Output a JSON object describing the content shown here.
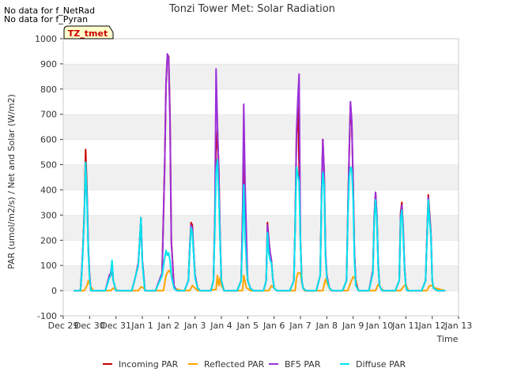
{
  "notes": [
    "No data for f_NetRad",
    "No data for f_Pyran"
  ],
  "site_badge": "TZ_tmet",
  "chart_data": {
    "type": "line",
    "title": "Tonzi Tower Met: Solar Radiation",
    "xlabel": "Time",
    "ylabel": "PAR (umol/m2/s) / Net and Solar (W/m2)",
    "ylim": [
      -100,
      1000
    ],
    "yticks": [
      -100,
      0,
      100,
      200,
      300,
      400,
      500,
      600,
      700,
      800,
      900,
      1000
    ],
    "xlim": [
      0,
      15
    ],
    "xticks": [
      {
        "v": 0,
        "label": "Dec 29"
      },
      {
        "v": 1,
        "label": "Dec 30"
      },
      {
        "v": 2,
        "label": "Dec 31"
      },
      {
        "v": 3,
        "label": "Jan 1"
      },
      {
        "v": 4,
        "label": "Jan 2"
      },
      {
        "v": 5,
        "label": "Jan 3"
      },
      {
        "v": 6,
        "label": "Jan 4"
      },
      {
        "v": 7,
        "label": "Jan 5"
      },
      {
        "v": 8,
        "label": "Jan 6"
      },
      {
        "v": 9,
        "label": "Jan 7"
      },
      {
        "v": 10,
        "label": "Jan 8"
      },
      {
        "v": 11,
        "label": "Jan 9"
      },
      {
        "v": 12,
        "label": "Jan 10"
      },
      {
        "v": 13,
        "label": "Jan 11"
      },
      {
        "v": 14,
        "label": "Jan 12"
      },
      {
        "v": 15,
        "label": "Jan 13"
      }
    ],
    "grid": "horizontal bands",
    "legend_position": "bottom",
    "series": [
      {
        "name": "Incoming PAR",
        "color": "#cc0000",
        "x": [
          0.4,
          0.65,
          0.7,
          0.75,
          0.8,
          0.85,
          0.9,
          0.95,
          1.0,
          1.05,
          1.1,
          1.2,
          1.35,
          1.6,
          1.75,
          1.8,
          1.85,
          1.9,
          2.0,
          2.1,
          2.2,
          2.6,
          2.75,
          2.85,
          2.9,
          2.95,
          3.0,
          3.05,
          3.1,
          3.15,
          3.5,
          3.75,
          3.85,
          3.9,
          3.95,
          4.0,
          4.05,
          4.1,
          4.2,
          4.3,
          4.6,
          4.75,
          4.8,
          4.85,
          4.9,
          4.95,
          5.0,
          5.1,
          5.2,
          5.6,
          5.7,
          5.75,
          5.8,
          5.85,
          5.9,
          5.95,
          6.0,
          6.1,
          6.2,
          6.6,
          6.75,
          6.8,
          6.85,
          6.9,
          6.95,
          7.0,
          7.1,
          7.2,
          7.6,
          7.7,
          7.75,
          7.8,
          7.85,
          7.9,
          7.95,
          8.0,
          8.1,
          8.2,
          8.6,
          8.75,
          8.8,
          8.85,
          8.9,
          8.95,
          9.0,
          9.05,
          9.1,
          9.2,
          9.3,
          9.6,
          9.75,
          9.8,
          9.85,
          9.9,
          9.95,
          10.0,
          10.1,
          10.2,
          10.6,
          10.75,
          10.8,
          10.85,
          10.9,
          10.95,
          11.0,
          11.05,
          11.1,
          11.2,
          11.3,
          11.6,
          11.75,
          11.8,
          11.85,
          11.9,
          11.95,
          12.0,
          12.1,
          12.2,
          12.6,
          12.75,
          12.8,
          12.85,
          12.9,
          12.95,
          13.0,
          13.05,
          13.2,
          13.6,
          13.75,
          13.8,
          13.85,
          13.9,
          13.95,
          14.0,
          14.05,
          14.2,
          14.5
        ],
        "y": [
          0,
          0,
          70,
          180,
          320,
          560,
          400,
          170,
          60,
          0,
          0,
          0,
          0,
          0,
          60,
          70,
          80,
          40,
          0,
          0,
          0,
          0,
          60,
          110,
          200,
          290,
          120,
          60,
          0,
          0,
          0,
          70,
          500,
          820,
          930,
          930,
          700,
          200,
          20,
          0,
          0,
          40,
          170,
          270,
          260,
          150,
          60,
          10,
          0,
          0,
          40,
          280,
          550,
          640,
          480,
          220,
          40,
          0,
          0,
          0,
          40,
          280,
          520,
          330,
          110,
          40,
          10,
          0,
          0,
          40,
          270,
          200,
          150,
          120,
          50,
          10,
          0,
          0,
          0,
          40,
          260,
          620,
          740,
          500,
          200,
          40,
          10,
          0,
          0,
          0,
          60,
          380,
          600,
          470,
          150,
          60,
          10,
          0,
          0,
          40,
          310,
          550,
          740,
          650,
          420,
          150,
          30,
          0,
          0,
          0,
          80,
          290,
          390,
          300,
          110,
          20,
          0,
          0,
          0,
          40,
          310,
          350,
          240,
          90,
          20,
          0,
          0,
          0,
          40,
          210,
          380,
          310,
          230,
          40,
          10,
          0,
          0
        ]
      },
      {
        "name": "Reflected PAR",
        "color": "#ffa500",
        "x": [
          0.4,
          0.8,
          0.9,
          0.95,
          1.05,
          1.15,
          1.5,
          1.8,
          1.9,
          2.0,
          2.1,
          2.5,
          2.85,
          2.95,
          3.05,
          3.15,
          3.5,
          3.8,
          3.9,
          4.0,
          4.1,
          4.2,
          4.5,
          4.8,
          4.9,
          5.0,
          5.1,
          5.5,
          5.8,
          5.85,
          5.9,
          5.95,
          6.0,
          6.1,
          6.5,
          6.8,
          6.85,
          6.95,
          7.05,
          7.1,
          7.5,
          7.8,
          7.9,
          8.0,
          8.1,
          8.5,
          8.8,
          8.85,
          8.9,
          9.0,
          9.05,
          9.15,
          9.5,
          9.85,
          9.95,
          10.05,
          10.15,
          10.5,
          10.8,
          10.9,
          11.0,
          11.1,
          11.2,
          11.5,
          11.85,
          11.95,
          12.05,
          12.15,
          12.5,
          12.8,
          12.9,
          13.0,
          13.1,
          13.5,
          13.8,
          13.9,
          14.0,
          14.1,
          14.5
        ],
        "y": [
          0,
          0,
          20,
          40,
          15,
          0,
          0,
          0,
          10,
          5,
          0,
          0,
          0,
          15,
          10,
          0,
          0,
          0,
          60,
          80,
          70,
          10,
          0,
          0,
          20,
          10,
          0,
          0,
          5,
          60,
          20,
          50,
          20,
          0,
          0,
          0,
          60,
          10,
          5,
          0,
          0,
          0,
          20,
          10,
          0,
          0,
          0,
          50,
          70,
          70,
          30,
          0,
          0,
          0,
          45,
          20,
          0,
          0,
          0,
          30,
          55,
          45,
          0,
          0,
          0,
          25,
          10,
          0,
          0,
          0,
          15,
          25,
          0,
          0,
          0,
          20,
          20,
          10,
          0
        ]
      },
      {
        "name": "BF5 PAR",
        "color": "#9b30d9",
        "x": [
          0.4,
          0.65,
          0.7,
          0.75,
          0.8,
          0.85,
          0.9,
          0.95,
          1.0,
          1.05,
          1.1,
          1.2,
          1.35,
          1.6,
          1.75,
          1.8,
          1.85,
          1.9,
          2.0,
          2.1,
          2.2,
          2.6,
          2.75,
          2.85,
          2.9,
          2.95,
          3.0,
          3.05,
          3.1,
          3.15,
          3.5,
          3.75,
          3.85,
          3.9,
          3.95,
          4.0,
          4.05,
          4.1,
          4.2,
          4.3,
          4.6,
          4.75,
          4.8,
          4.85,
          4.9,
          4.95,
          5.0,
          5.1,
          5.2,
          5.6,
          5.7,
          5.75,
          5.8,
          5.85,
          5.9,
          5.95,
          6.0,
          6.1,
          6.2,
          6.6,
          6.75,
          6.8,
          6.85,
          6.9,
          6.95,
          7.0,
          7.1,
          7.2,
          7.6,
          7.7,
          7.75,
          7.8,
          7.85,
          7.9,
          7.95,
          8.0,
          8.1,
          8.2,
          8.6,
          8.75,
          8.8,
          8.85,
          8.9,
          8.95,
          9.0,
          9.05,
          9.1,
          9.2,
          9.3,
          9.6,
          9.75,
          9.8,
          9.85,
          9.9,
          9.95,
          10.0,
          10.1,
          10.2,
          10.6,
          10.75,
          10.8,
          10.85,
          10.9,
          10.95,
          11.0,
          11.05,
          11.1,
          11.2,
          11.3,
          11.6,
          11.75,
          11.8,
          11.85,
          11.9,
          11.95,
          12.0,
          12.1,
          12.2,
          12.6,
          12.75,
          12.8,
          12.85,
          12.9,
          12.95,
          13.0,
          13.05,
          13.2,
          13.6,
          13.75,
          13.8,
          13.85,
          13.9,
          13.95,
          14.0,
          14.05,
          14.2,
          14.5
        ],
        "y": [
          0,
          0,
          70,
          180,
          300,
          510,
          380,
          160,
          60,
          0,
          0,
          0,
          0,
          0,
          60,
          70,
          110,
          40,
          0,
          0,
          0,
          0,
          60,
          110,
          200,
          280,
          120,
          60,
          0,
          0,
          0,
          70,
          500,
          820,
          940,
          920,
          680,
          190,
          20,
          0,
          0,
          40,
          170,
          260,
          250,
          150,
          60,
          10,
          0,
          0,
          40,
          270,
          880,
          660,
          470,
          220,
          40,
          0,
          0,
          0,
          40,
          270,
          740,
          420,
          210,
          40,
          10,
          0,
          0,
          40,
          260,
          200,
          150,
          120,
          50,
          10,
          0,
          0,
          0,
          40,
          260,
          620,
          760,
          860,
          200,
          40,
          10,
          0,
          0,
          0,
          60,
          380,
          600,
          470,
          150,
          60,
          10,
          0,
          0,
          40,
          310,
          550,
          750,
          670,
          420,
          150,
          30,
          0,
          0,
          0,
          80,
          290,
          390,
          300,
          110,
          20,
          0,
          0,
          0,
          40,
          300,
          340,
          240,
          90,
          20,
          0,
          0,
          0,
          40,
          210,
          370,
          300,
          230,
          40,
          10,
          0,
          0
        ]
      },
      {
        "name": "Diffuse PAR",
        "color": "#00e5ee",
        "x": [
          0.4,
          0.65,
          0.7,
          0.75,
          0.8,
          0.85,
          0.9,
          0.95,
          1.0,
          1.05,
          1.1,
          1.2,
          1.35,
          1.6,
          1.75,
          1.8,
          1.85,
          1.9,
          2.0,
          2.1,
          2.2,
          2.6,
          2.75,
          2.85,
          2.9,
          2.95,
          3.0,
          3.05,
          3.1,
          3.15,
          3.5,
          3.75,
          3.85,
          3.9,
          3.95,
          4.0,
          4.05,
          4.1,
          4.2,
          4.3,
          4.6,
          4.75,
          4.8,
          4.85,
          4.9,
          4.95,
          5.0,
          5.1,
          5.2,
          5.6,
          5.7,
          5.75,
          5.8,
          5.85,
          5.9,
          5.95,
          6.0,
          6.1,
          6.2,
          6.6,
          6.75,
          6.8,
          6.85,
          6.9,
          6.95,
          7.0,
          7.1,
          7.2,
          7.6,
          7.7,
          7.75,
          7.8,
          7.85,
          7.9,
          7.95,
          8.0,
          8.1,
          8.2,
          8.6,
          8.75,
          8.8,
          8.85,
          8.9,
          8.95,
          9.0,
          9.05,
          9.1,
          9.2,
          9.3,
          9.6,
          9.75,
          9.8,
          9.85,
          9.9,
          9.95,
          10.0,
          10.1,
          10.2,
          10.6,
          10.75,
          10.8,
          10.85,
          10.9,
          10.95,
          11.0,
          11.05,
          11.1,
          11.2,
          11.3,
          11.6,
          11.75,
          11.8,
          11.85,
          11.9,
          11.95,
          12.0,
          12.1,
          12.2,
          12.6,
          12.75,
          12.8,
          12.85,
          12.9,
          12.95,
          13.0,
          13.05,
          13.2,
          13.6,
          13.75,
          13.8,
          13.85,
          13.9,
          13.95,
          14.0,
          14.05,
          14.2,
          14.5
        ],
        "y": [
          0,
          0,
          60,
          170,
          300,
          510,
          360,
          150,
          50,
          0,
          0,
          0,
          0,
          0,
          50,
          60,
          120,
          40,
          0,
          0,
          0,
          0,
          60,
          100,
          200,
          290,
          110,
          50,
          0,
          0,
          0,
          60,
          130,
          160,
          140,
          150,
          120,
          60,
          10,
          0,
          0,
          40,
          160,
          250,
          230,
          140,
          50,
          10,
          0,
          0,
          40,
          240,
          470,
          520,
          380,
          200,
          40,
          0,
          0,
          0,
          40,
          200,
          420,
          210,
          120,
          40,
          10,
          0,
          0,
          40,
          230,
          150,
          120,
          110,
          50,
          10,
          0,
          0,
          0,
          40,
          250,
          490,
          460,
          430,
          190,
          40,
          10,
          0,
          0,
          0,
          60,
          360,
          470,
          420,
          130,
          50,
          10,
          0,
          0,
          40,
          290,
          450,
          490,
          480,
          360,
          120,
          20,
          0,
          0,
          0,
          70,
          270,
          360,
          280,
          100,
          20,
          0,
          0,
          0,
          40,
          280,
          320,
          220,
          80,
          20,
          0,
          0,
          0,
          40,
          200,
          360,
          280,
          220,
          40,
          10,
          0,
          0
        ]
      }
    ]
  }
}
